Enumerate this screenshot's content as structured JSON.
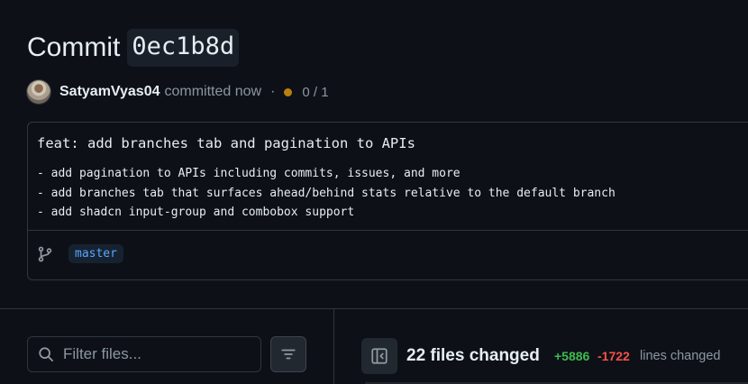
{
  "header": {
    "title_word": "Commit",
    "sha": "0ec1b8d"
  },
  "meta": {
    "author": "SatyamVyas04",
    "action": "committed now",
    "separator": "·",
    "checks": "0 / 1",
    "status_color": "#bb8009"
  },
  "commit_message": {
    "title": "feat: add branches tab and pagination to APIs",
    "body_lines": [
      "- add pagination to APIs including commits, issues, and more",
      "- add branches tab that surfaces ahead/behind stats relative to the default branch",
      "- add shadcn input-group and combobox support"
    ],
    "branch": "master"
  },
  "file_filter": {
    "placeholder": "Filter files..."
  },
  "summary": {
    "files_changed": "22 files changed",
    "additions": "+5886",
    "deletions": "-1722",
    "lines_changed": "lines changed"
  },
  "colors": {
    "background": "#0d1117",
    "border": "#30363d",
    "accent_blue": "#58a6ff",
    "additions_green": "#3fb950",
    "deletions_red": "#f85149"
  },
  "icons": [
    "branch-icon",
    "search-icon",
    "filter-icon",
    "sidebar-toggle-icon"
  ]
}
